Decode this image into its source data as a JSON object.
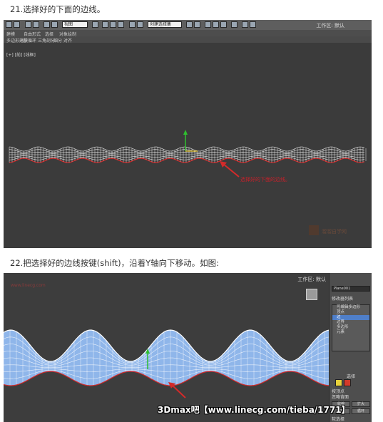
{
  "captions": {
    "step21": "21.选择好的下面的边线。",
    "step22": "22.把选择好的边线按键(shift)，沿着Y轴向下移动。如图:"
  },
  "shot1": {
    "app_title": "工作区: 默认",
    "view_dropdown": "视图",
    "selection_dropdown": "创建选择集",
    "menu": [
      "建模",
      "自由形式",
      "选择",
      "对象绘制"
    ],
    "submenu": [
      "多边形建模",
      "边",
      "循环",
      "三角剖分",
      "细分",
      "对齐"
    ],
    "viewport_label": "[+] [前] [线框]",
    "annotation": "选择好的下面的边线。",
    "watermark": "溜溜自学网",
    "colors": {
      "mesh": "#e8e8e8",
      "selected_edge": "#d42a2a",
      "axis_y": "#2fbf2f",
      "gizmo_x": "#e6c42a"
    }
  },
  "shot2": {
    "app_title": "工作区: 默认",
    "corner_text": "www.linecg.com",
    "panel": {
      "object_name": "Plane001",
      "modifier_list": "修改器列表",
      "stack": [
        "可编辑多边形",
        "顶点",
        "边",
        "边界",
        "多边形",
        "元素"
      ],
      "active_index": 2,
      "section_title": "选择",
      "checkboxes": [
        "按顶点",
        "忽略背面"
      ],
      "buttons": [
        "收缩",
        "扩大",
        "环形",
        "循环"
      ],
      "footer": "软选择"
    },
    "colors": {
      "surface": "#8fb6ea",
      "grid_line": "#ffffff",
      "selected_edge": "#d42a2a",
      "axis_y": "#2fbf2f"
    }
  },
  "banner": "3Dmax吧【www.linecg.com/tieba/1771】"
}
